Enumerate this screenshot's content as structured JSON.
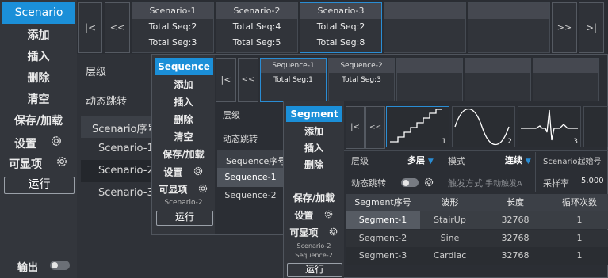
{
  "w1": {
    "title": "Scenario",
    "menu": [
      "添加",
      "插入",
      "删除",
      "清空",
      "保存/加载",
      "设置",
      "可显项"
    ],
    "run": "运行",
    "output": "输出",
    "nav": {
      "first": "|<",
      "prev": "<<",
      "next": ">>",
      "last": ">|"
    },
    "cards": [
      {
        "title": "Scenario-1",
        "seq": "Total Seq:2",
        "seg": "Total Seg:3"
      },
      {
        "title": "Scenario-2",
        "seq": "Total Seq:4",
        "seg": "Total Seg:5"
      },
      {
        "title": "Scenario-3",
        "seq": "Total Seq:2",
        "seg": "Total Seg:8"
      }
    ],
    "props": {
      "level": "层级",
      "dyn": "动态跳转"
    },
    "list_header": "Scenario序号",
    "list": [
      "Scenario-1",
      "Scenario-2",
      "Scenario-3"
    ]
  },
  "w2": {
    "title": "Sequence",
    "menu": [
      "添加",
      "插入",
      "删除",
      "清空",
      "保存/加载",
      "设置",
      "可显项"
    ],
    "context": "Scenario-2",
    "run": "运行",
    "nav": {
      "first": "|<",
      "prev": "<<"
    },
    "cards": [
      {
        "title": "Sequence-1",
        "sub": "Total Seg:1"
      },
      {
        "title": "Sequence-2",
        "sub": "Total Seg:3"
      }
    ],
    "props": {
      "level": "层级",
      "dyn": "动态跳转"
    },
    "list_header": "Sequence序号",
    "list": [
      "Sequence-1",
      "Sequence-2"
    ]
  },
  "w3": {
    "title": "Segment",
    "menu": [
      "添加",
      "插入",
      "删除",
      "保存/加载",
      "设置",
      "可显项"
    ],
    "context1": "Scenario-2",
    "context2": "Sequence-2",
    "run": "运行",
    "nav": {
      "first": "|<",
      "prev": "<<"
    },
    "thumbs": [
      {
        "num": "1",
        "wave": "stair"
      },
      {
        "num": "2",
        "wave": "sine"
      },
      {
        "num": "3",
        "wave": "cardiac"
      }
    ],
    "props": {
      "level_label": "层级",
      "level_value": "多层",
      "mode_label": "模式",
      "mode_value": "连续",
      "start_label": "Scenario起始号",
      "dyn": "动态跳转",
      "trigger_label": "触发方式",
      "trigger_value": "手动触发A",
      "rate_label": "采样率",
      "rate_value": "5.000"
    },
    "table": {
      "headers": [
        "Segment序号",
        "波形",
        "长度",
        "循环次数"
      ],
      "rows": [
        [
          "Segment-1",
          "StairUp",
          "32768",
          "1"
        ],
        [
          "Segment-2",
          "Sine",
          "32768",
          "1"
        ],
        [
          "Segment-3",
          "Cardiac",
          "32768",
          "1"
        ]
      ]
    }
  },
  "colors": {
    "accent": "#1b8fd8",
    "panel": "#2b2e34",
    "sidebar": "#33363c"
  }
}
